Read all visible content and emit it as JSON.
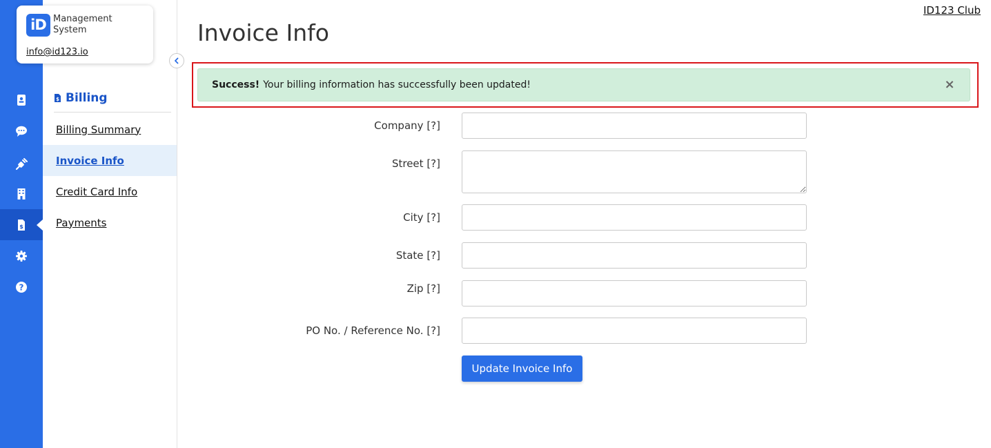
{
  "brand": {
    "logo_text": "iD",
    "name_line1": "Management",
    "name_line2": "System",
    "email": "info@id123.io"
  },
  "rail": {
    "icons": [
      {
        "name": "id-card-icon"
      },
      {
        "name": "chat-icon"
      },
      {
        "name": "plug-icon"
      },
      {
        "name": "building-icon"
      },
      {
        "name": "billing-icon",
        "active": true
      },
      {
        "name": "gear-icon"
      },
      {
        "name": "help-icon"
      }
    ]
  },
  "sidebar": {
    "section_title": "Billing",
    "items": [
      {
        "label": "Billing Summary"
      },
      {
        "label": "Invoice Info",
        "active": true
      },
      {
        "label": "Credit Card Info"
      },
      {
        "label": "Payments"
      }
    ]
  },
  "header": {
    "club_link": "ID123 Club",
    "page_title": "Invoice Info"
  },
  "alert": {
    "strong": "Success!",
    "message": "Your billing information has successfully been updated!",
    "close": "×"
  },
  "form": {
    "fields": [
      {
        "label": "Company",
        "help": "[?]",
        "value": ""
      },
      {
        "label": "Street",
        "help": "[?]",
        "value": ""
      },
      {
        "label": "City",
        "help": "[?]",
        "value": ""
      },
      {
        "label": "State",
        "help": "[?]",
        "value": ""
      },
      {
        "label": "Zip",
        "help": "[?]",
        "value": ""
      },
      {
        "label": "PO No. / Reference No.",
        "help": "[?]",
        "value": ""
      }
    ],
    "submit_label": "Update Invoice Info"
  },
  "colors": {
    "rail": "#2a6ee6",
    "rail_active": "#1a55c8",
    "alert_bg": "#d1eedb",
    "highlight": "#d9161a"
  }
}
